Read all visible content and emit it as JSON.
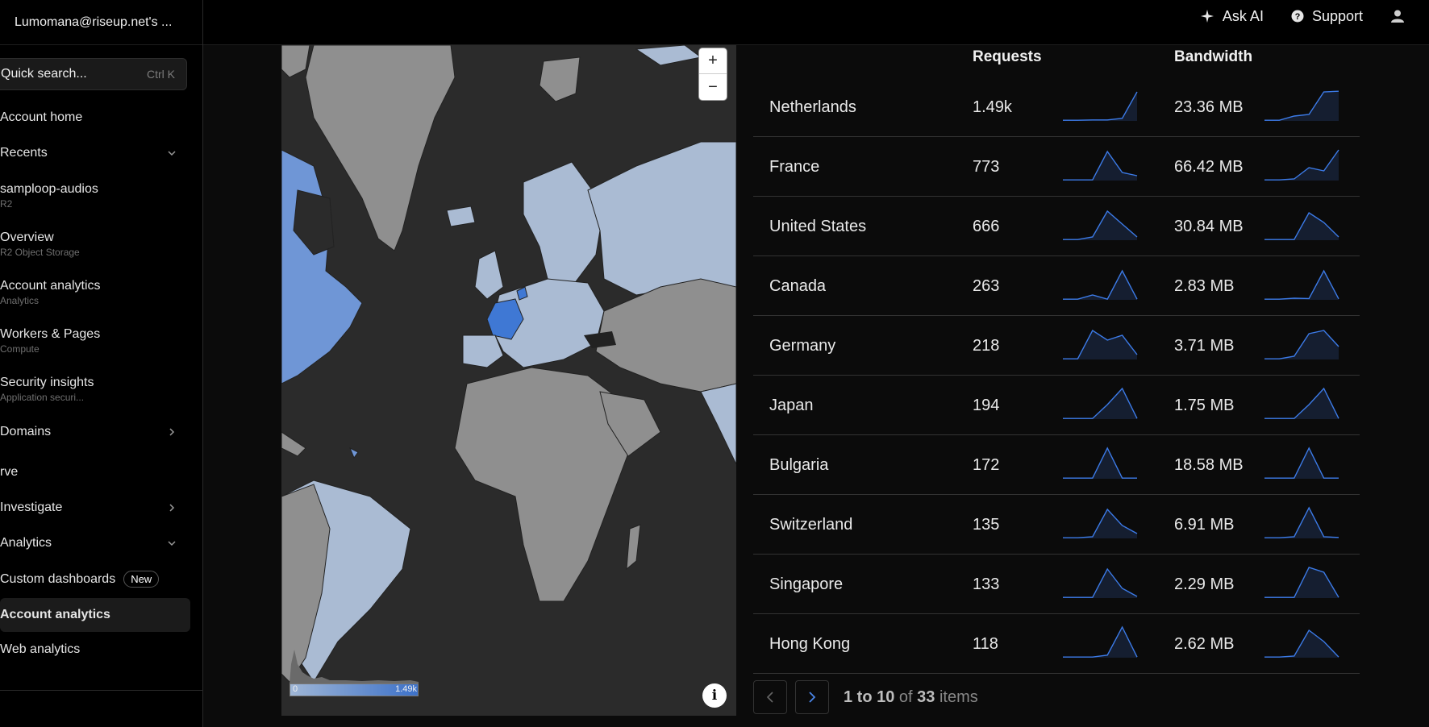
{
  "account": {
    "name": "Lumomana@riseup.net's ..."
  },
  "topbar": {
    "ask_ai": "Ask AI",
    "support": "Support"
  },
  "search": {
    "placeholder": "Quick search...",
    "shortcut": "Ctrl K"
  },
  "sidebar": {
    "items": [
      {
        "label": "Account home",
        "sub": ""
      },
      {
        "label": "Recents",
        "sub": ""
      },
      {
        "label": "samploop-audios",
        "sub": "R2"
      },
      {
        "label": "Overview",
        "sub": "R2 Object Storage"
      },
      {
        "label": "Account analytics",
        "sub": "Analytics"
      },
      {
        "label": "Workers & Pages",
        "sub": "Compute"
      },
      {
        "label": "Security insights",
        "sub": "Application securi..."
      },
      {
        "label": "Domains",
        "sub": ""
      },
      {
        "label": "rve",
        "sub": ""
      },
      {
        "label": "Investigate",
        "sub": ""
      },
      {
        "label": "Analytics",
        "sub": ""
      },
      {
        "label": "Custom dashboards",
        "sub": "",
        "badge": "New"
      },
      {
        "label": "Account analytics",
        "sub": ""
      },
      {
        "label": "Web analytics",
        "sub": ""
      }
    ]
  },
  "map": {
    "legend_min": "0",
    "legend_max": "1.49k",
    "zoom_in": "+",
    "zoom_out": "−",
    "info": "i",
    "highlight_colors": {
      "high": "#3f78d4",
      "mid": "#6f96d6",
      "low": "#aabbd3",
      "none": "#8f8f8f"
    }
  },
  "table": {
    "headers": {
      "requests": "Requests",
      "bandwidth": "Bandwidth"
    },
    "rows": [
      {
        "country": "Netherlands",
        "requests": "1.49k",
        "bandwidth": "23.36 MB",
        "req_trend": [
          0.02,
          0.02,
          0.03,
          0.03,
          0.08,
          0.9
        ],
        "bw_trend": [
          0.02,
          0.02,
          0.15,
          0.2,
          0.9,
          0.92
        ]
      },
      {
        "country": "France",
        "requests": "773",
        "bandwidth": "66.42 MB",
        "req_trend": [
          0.02,
          0.02,
          0.02,
          0.9,
          0.25,
          0.15
        ],
        "bw_trend": [
          0.02,
          0.02,
          0.05,
          0.4,
          0.3,
          0.95
        ]
      },
      {
        "country": "United States",
        "requests": "666",
        "bandwidth": "30.84 MB",
        "req_trend": [
          0.02,
          0.02,
          0.1,
          0.9,
          0.5,
          0.1
        ],
        "bw_trend": [
          0.02,
          0.02,
          0.02,
          0.85,
          0.55,
          0.1
        ]
      },
      {
        "country": "Canada",
        "requests": "263",
        "bandwidth": "2.83 MB",
        "req_trend": [
          0.02,
          0.02,
          0.15,
          0.02,
          0.9,
          0.02
        ],
        "bw_trend": [
          0.02,
          0.02,
          0.05,
          0.04,
          0.9,
          0.03
        ]
      },
      {
        "country": "Germany",
        "requests": "218",
        "bandwidth": "3.71 MB",
        "req_trend": [
          0.02,
          0.02,
          0.9,
          0.6,
          0.75,
          0.15
        ],
        "bw_trend": [
          0.02,
          0.02,
          0.1,
          0.8,
          0.9,
          0.4
        ]
      },
      {
        "country": "Japan",
        "requests": "194",
        "bandwidth": "1.75 MB",
        "req_trend": [
          0.02,
          0.02,
          0.02,
          0.45,
          0.95,
          0.02
        ],
        "bw_trend": [
          0.02,
          0.02,
          0.02,
          0.45,
          0.95,
          0.02
        ]
      },
      {
        "country": "Bulgaria",
        "requests": "172",
        "bandwidth": "18.58 MB",
        "req_trend": [
          0.02,
          0.02,
          0.02,
          0.95,
          0.02,
          0.02
        ],
        "bw_trend": [
          0.02,
          0.02,
          0.02,
          0.95,
          0.02,
          0.02
        ]
      },
      {
        "country": "Switzerland",
        "requests": "135",
        "bandwidth": "6.91 MB",
        "req_trend": [
          0.02,
          0.02,
          0.05,
          0.9,
          0.4,
          0.15
        ],
        "bw_trend": [
          0.02,
          0.02,
          0.05,
          0.95,
          0.05,
          0.03
        ]
      },
      {
        "country": "Singapore",
        "requests": "133",
        "bandwidth": "2.29 MB",
        "req_trend": [
          0.02,
          0.02,
          0.02,
          0.9,
          0.3,
          0.05
        ],
        "bw_trend": [
          0.02,
          0.02,
          0.02,
          0.95,
          0.8,
          0.02
        ]
      },
      {
        "country": "Hong Kong",
        "requests": "118",
        "bandwidth": "2.62 MB",
        "req_trend": [
          0.02,
          0.02,
          0.02,
          0.08,
          0.95,
          0.02
        ],
        "bw_trend": [
          0.02,
          0.02,
          0.05,
          0.85,
          0.5,
          0.02
        ]
      }
    ]
  },
  "pagination": {
    "range": "1 to 10",
    "of": "of",
    "total": "33",
    "items": "items"
  },
  "colors": {
    "spark_line": "#3c7be8",
    "accent": "#4a86e8"
  }
}
